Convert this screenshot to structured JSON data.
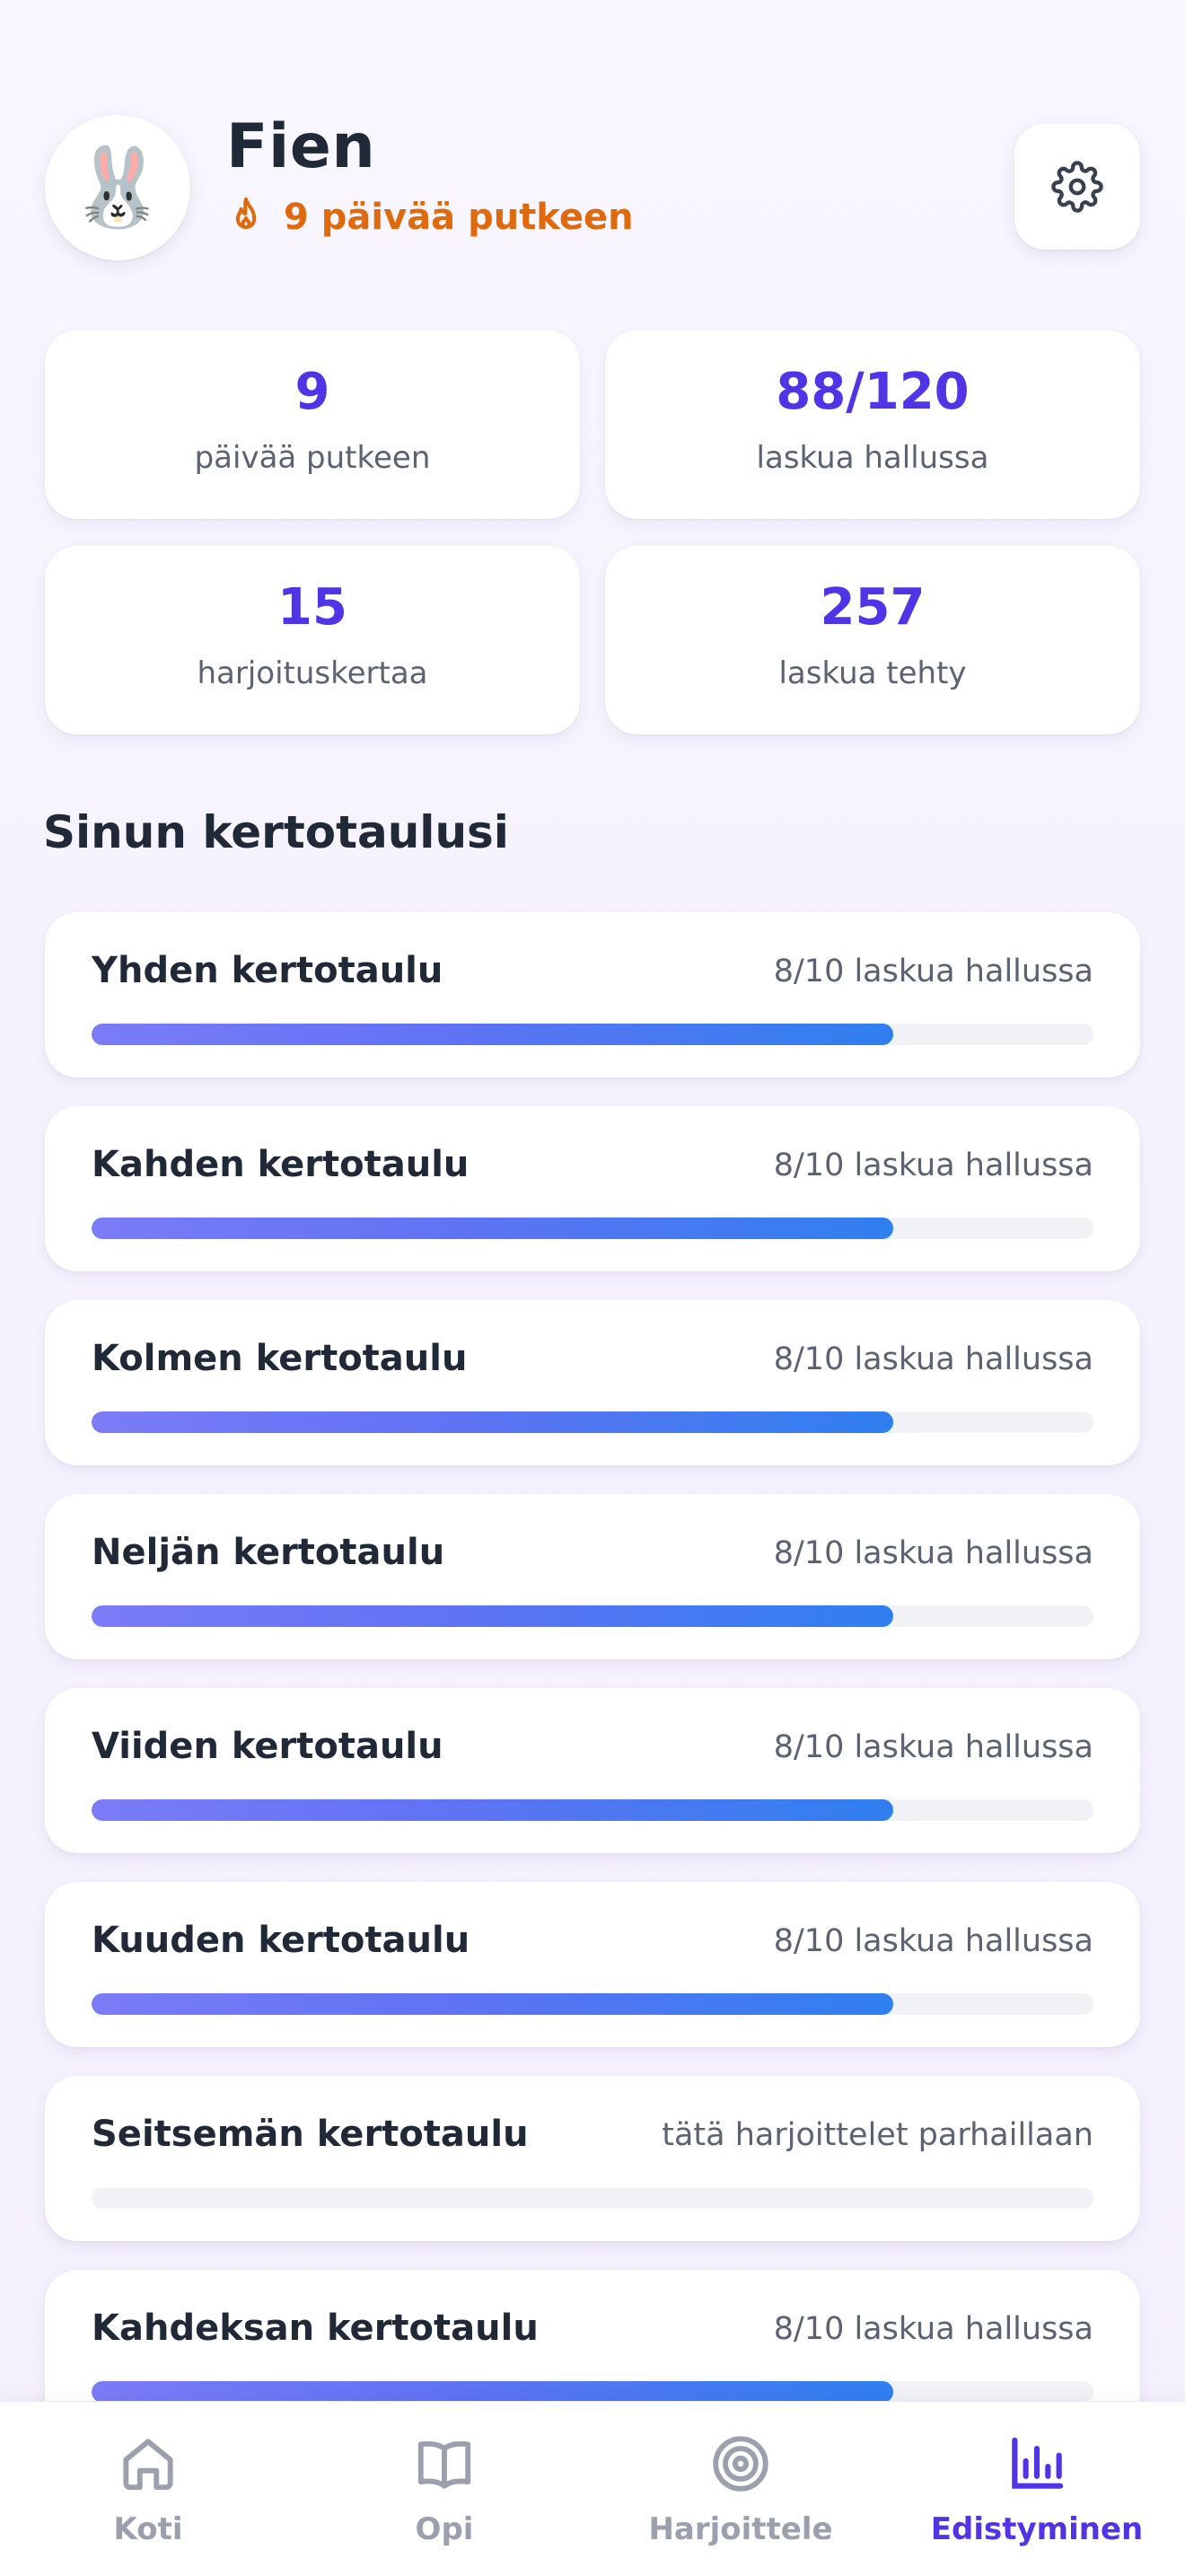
{
  "profile": {
    "avatar_emoji": "🐰",
    "name": "Fien",
    "streak_text": "9 päivää putkeen"
  },
  "stats": [
    {
      "value": "9",
      "label": "päivää putkeen"
    },
    {
      "value": "88/120",
      "label": "laskua hallussa"
    },
    {
      "value": "15",
      "label": "harjoituskertaa"
    },
    {
      "value": "257",
      "label": "laskua tehty"
    }
  ],
  "section_title": "Sinun kertotaulusi",
  "tables": [
    {
      "name": "Yhden kertotaulu",
      "status": "8/10 laskua hallussa",
      "progress": 0.8
    },
    {
      "name": "Kahden kertotaulu",
      "status": "8/10 laskua hallussa",
      "progress": 0.8
    },
    {
      "name": "Kolmen kertotaulu",
      "status": "8/10 laskua hallussa",
      "progress": 0.8
    },
    {
      "name": "Neljän kertotaulu",
      "status": "8/10 laskua hallussa",
      "progress": 0.8
    },
    {
      "name": "Viiden kertotaulu",
      "status": "8/10 laskua hallussa",
      "progress": 0.8
    },
    {
      "name": "Kuuden kertotaulu",
      "status": "8/10 laskua hallussa",
      "progress": 0.8
    },
    {
      "name": "Seitsemän kertotaulu",
      "status": "tätä harjoittelet parhaillaan",
      "progress": 0
    },
    {
      "name": "Kahdeksan kertotaulu",
      "status": "8/10 laskua hallussa",
      "progress": 0.8
    }
  ],
  "nav": [
    {
      "label": "Koti",
      "icon": "home-icon",
      "active": false
    },
    {
      "label": "Opi",
      "icon": "book-icon",
      "active": false
    },
    {
      "label": "Harjoittele",
      "icon": "target-icon",
      "active": false
    },
    {
      "label": "Edistyminen",
      "icon": "bar-chart-icon",
      "active": true
    }
  ],
  "colors": {
    "accent": "#4f35e6",
    "streak": "#e06a0b",
    "progress_start": "#7b7cf6",
    "progress_end": "#2f7ff0",
    "nav_inactive": "#9aa0ad"
  }
}
